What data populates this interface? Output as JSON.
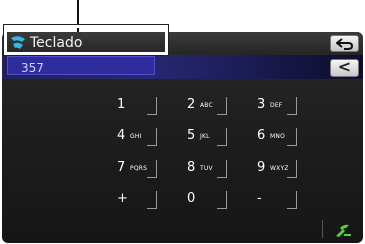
{
  "header": {
    "title": "Teclado"
  },
  "input": {
    "value": "357"
  },
  "buttons": {
    "backspace_label": "<"
  },
  "keypad": [
    {
      "num": "1",
      "letters": ""
    },
    {
      "num": "2",
      "letters": "ABC"
    },
    {
      "num": "3",
      "letters": "DEF"
    },
    {
      "num": "4",
      "letters": "GHI"
    },
    {
      "num": "5",
      "letters": "JKL"
    },
    {
      "num": "6",
      "letters": "MNO"
    },
    {
      "num": "7",
      "letters": "PQRS"
    },
    {
      "num": "8",
      "letters": "TUV"
    },
    {
      "num": "9",
      "letters": "WXYZ"
    },
    {
      "num": "+",
      "letters": ""
    },
    {
      "num": "0",
      "letters": ""
    },
    {
      "num": "-",
      "letters": ""
    }
  ],
  "colors": {
    "accent": "#2d2d9e",
    "icon_cyan": "#2fb8e8",
    "call_green": "#5fcf3f"
  }
}
